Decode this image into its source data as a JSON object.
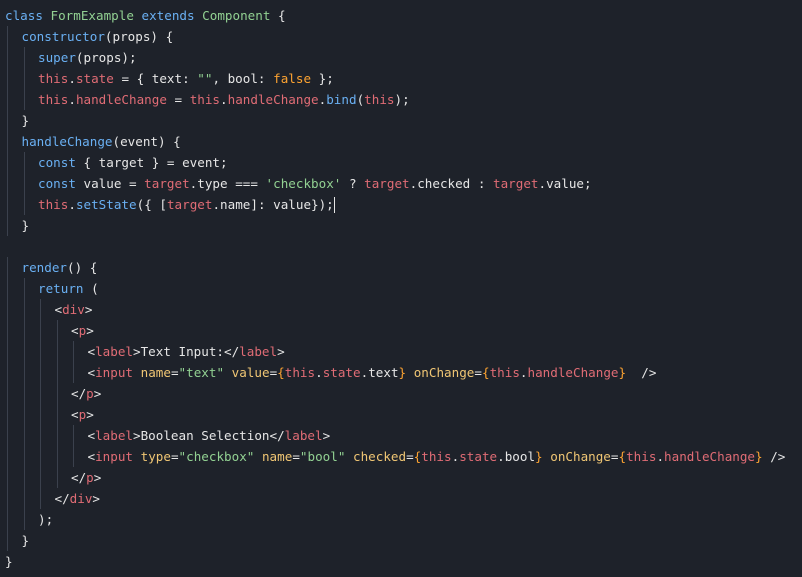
{
  "theme": {
    "background": "#1e222a",
    "colors": {
      "keyword": "#6ab0f3",
      "class": "#92d192",
      "function": "#6ab0f3",
      "property": "#e06c75",
      "punctuation": "#e6e6e6",
      "string": "#92d192",
      "operator": "#e6e6e6",
      "boolean": "#fda331",
      "tag": "#e06c75",
      "attribute": "#f0c674",
      "plain": "#e6e6e6",
      "guide": "#3b414d"
    }
  },
  "editor": {
    "cursor_line": 10,
    "lines": [
      {
        "indent": 0,
        "tokens": [
          [
            "keyword",
            "class "
          ],
          [
            "class",
            "FormExample "
          ],
          [
            "keyword",
            "extends "
          ],
          [
            "class",
            "Component"
          ],
          [
            "plain",
            " {"
          ]
        ]
      },
      {
        "indent": 1,
        "tokens": [
          [
            "function",
            "constructor"
          ],
          [
            "plain",
            "(props) {"
          ]
        ]
      },
      {
        "indent": 2,
        "tokens": [
          [
            "keyword",
            "super"
          ],
          [
            "plain",
            "(props);"
          ]
        ]
      },
      {
        "indent": 2,
        "tokens": [
          [
            "property",
            "this"
          ],
          [
            "plain",
            "."
          ],
          [
            "property",
            "state"
          ],
          [
            "plain",
            " = { text: "
          ],
          [
            "string",
            "\"\""
          ],
          [
            "plain",
            ", bool: "
          ],
          [
            "boolean",
            "false"
          ],
          [
            "plain",
            " };"
          ]
        ]
      },
      {
        "indent": 2,
        "tokens": [
          [
            "property",
            "this"
          ],
          [
            "plain",
            "."
          ],
          [
            "property",
            "handleChange"
          ],
          [
            "plain",
            " = "
          ],
          [
            "property",
            "this"
          ],
          [
            "plain",
            "."
          ],
          [
            "property",
            "handleChange"
          ],
          [
            "plain",
            "."
          ],
          [
            "function",
            "bind"
          ],
          [
            "plain",
            "("
          ],
          [
            "property",
            "this"
          ],
          [
            "plain",
            ");"
          ]
        ]
      },
      {
        "indent": 1,
        "tokens": [
          [
            "plain",
            "}"
          ]
        ]
      },
      {
        "indent": 1,
        "tokens": [
          [
            "function",
            "handleChange"
          ],
          [
            "plain",
            "(event) {"
          ]
        ]
      },
      {
        "indent": 2,
        "tokens": [
          [
            "keyword",
            "const"
          ],
          [
            "plain",
            " { target } = event;"
          ]
        ]
      },
      {
        "indent": 2,
        "tokens": [
          [
            "keyword",
            "const"
          ],
          [
            "plain",
            " value = "
          ],
          [
            "property",
            "target"
          ],
          [
            "plain",
            "."
          ],
          [
            "plain",
            "type"
          ],
          [
            "plain",
            " === "
          ],
          [
            "string",
            "'checkbox'"
          ],
          [
            "plain",
            " ? "
          ],
          [
            "property",
            "target"
          ],
          [
            "plain",
            ".checked : "
          ],
          [
            "property",
            "target"
          ],
          [
            "plain",
            ".value;"
          ]
        ]
      },
      {
        "indent": 2,
        "tokens": [
          [
            "property",
            "this"
          ],
          [
            "plain",
            "."
          ],
          [
            "function",
            "setState"
          ],
          [
            "plain",
            "({ ["
          ],
          [
            "property",
            "target"
          ],
          [
            "plain",
            ".name]: value});"
          ]
        ]
      },
      {
        "indent": 1,
        "tokens": [
          [
            "plain",
            "}"
          ]
        ]
      },
      {
        "indent": 0,
        "tokens": [
          [
            "plain",
            ""
          ]
        ]
      },
      {
        "indent": 1,
        "tokens": [
          [
            "function",
            "render"
          ],
          [
            "plain",
            "() {"
          ]
        ]
      },
      {
        "indent": 2,
        "tokens": [
          [
            "keyword",
            "return"
          ],
          [
            "plain",
            " ("
          ]
        ]
      },
      {
        "indent": 3,
        "tokens": [
          [
            "plain",
            "<"
          ],
          [
            "tag",
            "div"
          ],
          [
            "plain",
            ">"
          ]
        ]
      },
      {
        "indent": 4,
        "tokens": [
          [
            "plain",
            "<"
          ],
          [
            "tag",
            "p"
          ],
          [
            "plain",
            ">"
          ]
        ]
      },
      {
        "indent": 5,
        "tokens": [
          [
            "plain",
            "<"
          ],
          [
            "tag",
            "label"
          ],
          [
            "plain",
            ">Text Input:</"
          ],
          [
            "tag",
            "label"
          ],
          [
            "plain",
            ">"
          ]
        ]
      },
      {
        "indent": 5,
        "tokens": [
          [
            "plain",
            "<"
          ],
          [
            "tag",
            "input"
          ],
          [
            "plain",
            " "
          ],
          [
            "attribute",
            "name"
          ],
          [
            "plain",
            "="
          ],
          [
            "string",
            "\"text\""
          ],
          [
            "plain",
            " "
          ],
          [
            "attribute",
            "value"
          ],
          [
            "plain",
            "="
          ],
          [
            "boolean",
            "{"
          ],
          [
            "property",
            "this"
          ],
          [
            "plain",
            "."
          ],
          [
            "property",
            "state"
          ],
          [
            "plain",
            ".text"
          ],
          [
            "boolean",
            "}"
          ],
          [
            "plain",
            " "
          ],
          [
            "attribute",
            "onChange"
          ],
          [
            "plain",
            "="
          ],
          [
            "boolean",
            "{"
          ],
          [
            "property",
            "this"
          ],
          [
            "plain",
            "."
          ],
          [
            "property",
            "handleChange"
          ],
          [
            "boolean",
            "}"
          ],
          [
            "plain",
            "  />"
          ]
        ]
      },
      {
        "indent": 4,
        "tokens": [
          [
            "plain",
            "</"
          ],
          [
            "tag",
            "p"
          ],
          [
            "plain",
            ">"
          ]
        ]
      },
      {
        "indent": 4,
        "tokens": [
          [
            "plain",
            "<"
          ],
          [
            "tag",
            "p"
          ],
          [
            "plain",
            ">"
          ]
        ]
      },
      {
        "indent": 5,
        "tokens": [
          [
            "plain",
            "<"
          ],
          [
            "tag",
            "label"
          ],
          [
            "plain",
            ">Boolean Selection</"
          ],
          [
            "tag",
            "label"
          ],
          [
            "plain",
            ">"
          ]
        ]
      },
      {
        "indent": 5,
        "tokens": [
          [
            "plain",
            "<"
          ],
          [
            "tag",
            "input"
          ],
          [
            "plain",
            " "
          ],
          [
            "attribute",
            "type"
          ],
          [
            "plain",
            "="
          ],
          [
            "string",
            "\"checkbox\""
          ],
          [
            "plain",
            " "
          ],
          [
            "attribute",
            "name"
          ],
          [
            "plain",
            "="
          ],
          [
            "string",
            "\"bool\""
          ],
          [
            "plain",
            " "
          ],
          [
            "attribute",
            "checked"
          ],
          [
            "plain",
            "="
          ],
          [
            "boolean",
            "{"
          ],
          [
            "property",
            "this"
          ],
          [
            "plain",
            "."
          ],
          [
            "property",
            "state"
          ],
          [
            "plain",
            ".bool"
          ],
          [
            "boolean",
            "}"
          ],
          [
            "plain",
            " "
          ],
          [
            "attribute",
            "onChange"
          ],
          [
            "plain",
            "="
          ],
          [
            "boolean",
            "{"
          ],
          [
            "property",
            "this"
          ],
          [
            "plain",
            "."
          ],
          [
            "property",
            "handleChange"
          ],
          [
            "boolean",
            "}"
          ],
          [
            "plain",
            " />"
          ]
        ]
      },
      {
        "indent": 4,
        "tokens": [
          [
            "plain",
            "</"
          ],
          [
            "tag",
            "p"
          ],
          [
            "plain",
            ">"
          ]
        ]
      },
      {
        "indent": 3,
        "tokens": [
          [
            "plain",
            "</"
          ],
          [
            "tag",
            "div"
          ],
          [
            "plain",
            ">"
          ]
        ]
      },
      {
        "indent": 2,
        "tokens": [
          [
            "plain",
            ");"
          ]
        ]
      },
      {
        "indent": 1,
        "tokens": [
          [
            "plain",
            "}"
          ]
        ]
      },
      {
        "indent": 0,
        "tokens": [
          [
            "plain",
            "}"
          ]
        ]
      }
    ]
  }
}
